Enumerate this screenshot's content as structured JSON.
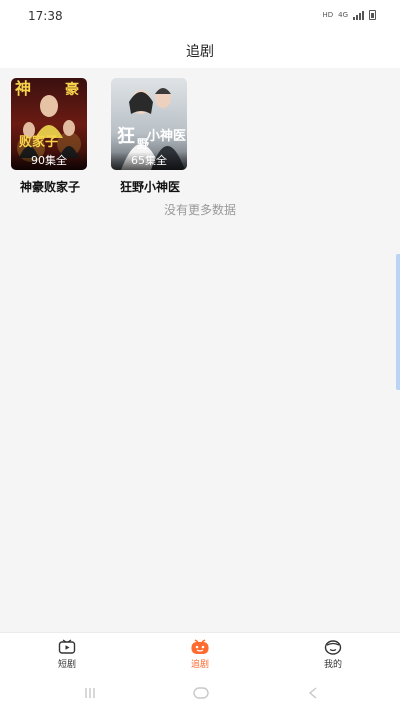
{
  "status_bar": {
    "time": "17:38",
    "hd_label": "HD",
    "network_label": "4G"
  },
  "header": {
    "title": "追剧"
  },
  "dramas": [
    {
      "title": "神豪败家子",
      "episodes": "90集全",
      "poster_text": "神豪败家子"
    },
    {
      "title": "狂野小神医",
      "episodes": "65集全",
      "poster_text": "狂野小神医"
    }
  ],
  "list_end_text": "没有更多数据",
  "tabbar": {
    "items": [
      {
        "label": "短剧",
        "icon": "play-tv-icon",
        "active": false
      },
      {
        "label": "追剧",
        "icon": "follow-drama-icon",
        "active": true
      },
      {
        "label": "我的",
        "icon": "profile-face-icon",
        "active": false
      }
    ]
  },
  "colors": {
    "accent": "#ff6a2f",
    "background": "#f5f5f5"
  },
  "system_nav": {
    "icons": [
      "recents-icon",
      "home-icon",
      "back-icon"
    ]
  }
}
